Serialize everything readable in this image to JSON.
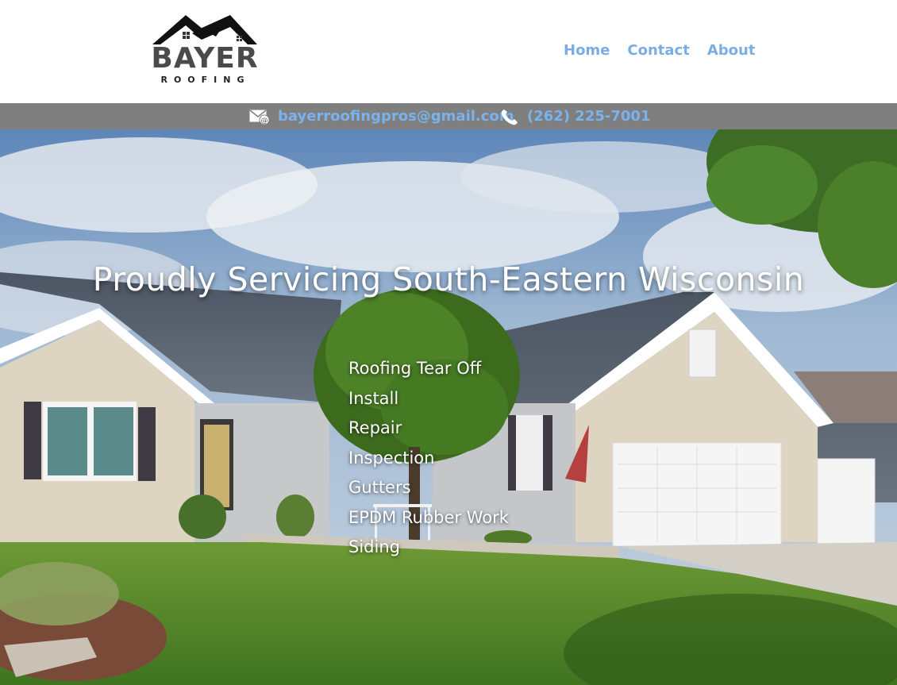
{
  "header": {
    "logo": {
      "wordmark": "BAYER",
      "subtitle": "ROOFING"
    },
    "nav": [
      {
        "label": "Home"
      },
      {
        "label": "Contact"
      },
      {
        "label": "About"
      }
    ]
  },
  "contact_bar": {
    "email": {
      "icon": "envelope-at-icon",
      "text": "bayerroofingpros@gmail.com"
    },
    "phone": {
      "icon": "phone-icon",
      "text": "(262) 225-7001"
    }
  },
  "hero": {
    "title": "Proudly Servicing South-Eastern Wisconsin",
    "services": [
      "Roofing Tear Off",
      "Install",
      "Repair",
      "Inspection",
      "Gutters",
      "EPDM Rubber Work",
      "Siding"
    ]
  },
  "colors": {
    "nav_link": "#7aaee3",
    "contact_bar_bg": "#7f7f7f",
    "contact_text": "#7ab2ee",
    "hero_text": "#ffffff"
  }
}
